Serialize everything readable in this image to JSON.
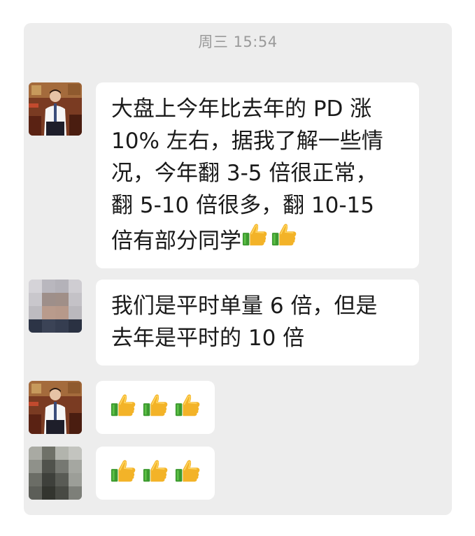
{
  "chat": {
    "timestamp": "周三 15:54",
    "messages": [
      {
        "sender": "male-suit-avatar",
        "text": "大盘上今年比去年的 PD 涨\n10% 左右，据我了解一些情\n况，今年翻 3-5 倍很正常，\n翻 5-10 倍很多，翻 10-15\n倍有部分同学",
        "emojis": [
          "thumbs-up-emoji",
          "thumbs-up-emoji"
        ]
      },
      {
        "sender": "blurred-avatar",
        "text": "我们是平时单量 6 倍，但是\n去年是平时的 10 倍",
        "emojis": []
      },
      {
        "sender": "male-suit-avatar",
        "text": "",
        "emojis": [
          "thumbs-up-emoji",
          "thumbs-up-emoji",
          "thumbs-up-emoji"
        ]
      },
      {
        "sender": "blurred-avatar-2",
        "text": "",
        "emojis": [
          "thumbs-up-emoji",
          "thumbs-up-emoji",
          "thumbs-up-emoji"
        ]
      }
    ]
  },
  "colors": {
    "background": "#ededed",
    "bubble": "#ffffff",
    "timestamp": "#9a9a9a",
    "text": "#1a1a1a"
  }
}
